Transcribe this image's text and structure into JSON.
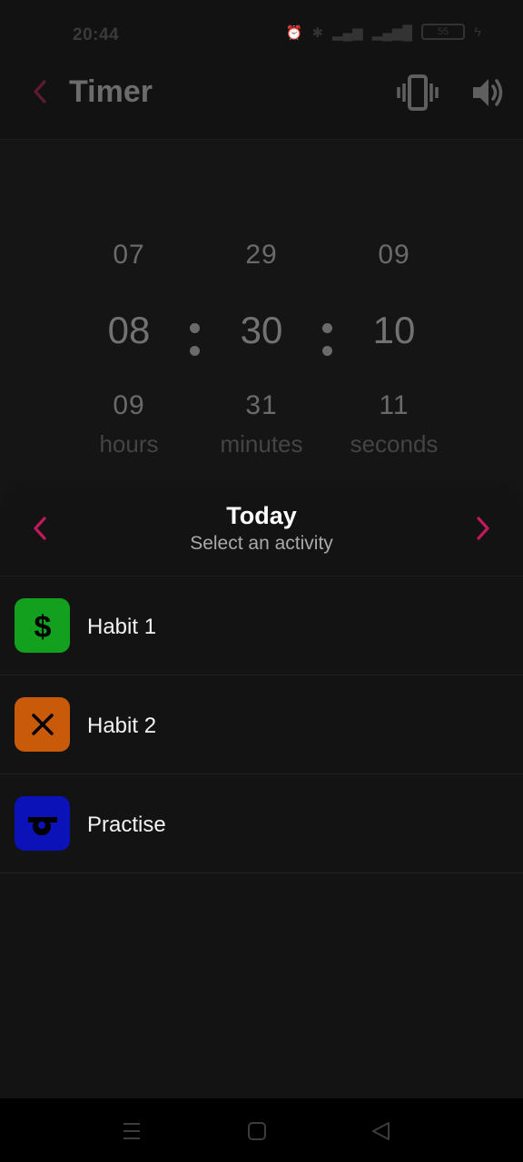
{
  "status": {
    "time": "20:44",
    "battery": "55"
  },
  "app_bar": {
    "title": "Timer"
  },
  "picker": {
    "hours": {
      "prev": "07",
      "current": "08",
      "next": "09",
      "unit": "hours"
    },
    "minutes": {
      "prev": "29",
      "current": "30",
      "next": "31",
      "unit": "minutes"
    },
    "seconds": {
      "prev": "09",
      "current": "10",
      "next": "11",
      "unit": "seconds"
    }
  },
  "sheet": {
    "title": "Today",
    "subtitle": "Select an activity",
    "activities": [
      {
        "label": "Habit 1",
        "icon": "dollar-icon",
        "color": "#13a01e"
      },
      {
        "label": "Habit 2",
        "icon": "close-icon",
        "color": "#c85a0a"
      },
      {
        "label": "Practise",
        "icon": "whistle-icon",
        "color": "#0a12b8"
      }
    ]
  },
  "colors": {
    "accent": "#c2185b",
    "background": "#151515",
    "sheet": "#131313"
  }
}
